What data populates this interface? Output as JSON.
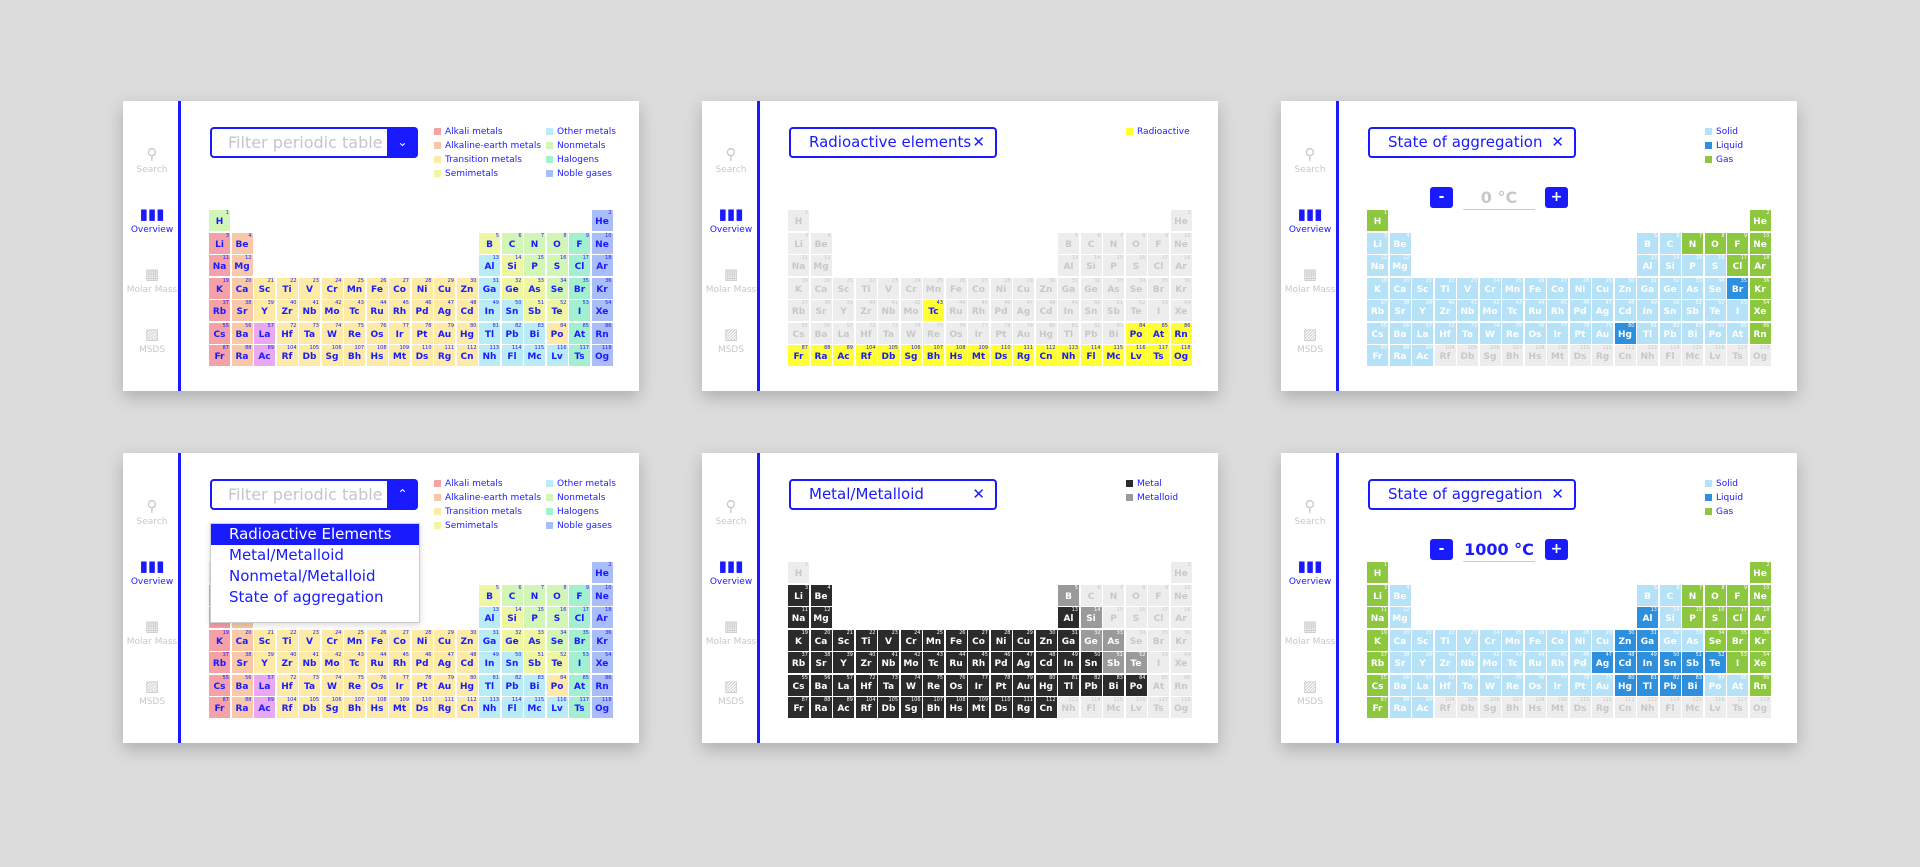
{
  "sidebar": {
    "items": [
      {
        "label": "Search",
        "icon": "search-icon"
      },
      {
        "label": "Overview",
        "icon": "chart-icon"
      },
      {
        "label": "Molar Mass",
        "icon": "calculator-icon"
      },
      {
        "label": "MSDS",
        "icon": "document-icon"
      }
    ]
  },
  "filter": {
    "placeholder": "Filter periodic table",
    "options": [
      "Radioactive Elements",
      "Metal/Metalloid",
      "Nonmetal/Metalloid",
      "State of aggregation"
    ]
  },
  "chips": {
    "radioactive": "Radioactive elements",
    "metal": "Metal/Metalloid",
    "state": "State of aggregation",
    "close": "✕"
  },
  "legends": {
    "categories": [
      {
        "label": "Alkali metals",
        "color": "#f4a1a8"
      },
      {
        "label": "Alkaline-earth metals",
        "color": "#f8c8a8"
      },
      {
        "label": "Transition metals",
        "color": "#fdeaa6"
      },
      {
        "label": "Semimetals",
        "color": "#eef5a3"
      },
      {
        "label": "Other metals",
        "color": "#b9ecf4"
      },
      {
        "label": "Nonmetals",
        "color": "#d2f6b5"
      },
      {
        "label": "Halogens",
        "color": "#a3f0d0"
      },
      {
        "label": "Noble gases",
        "color": "#a9bdf8"
      }
    ],
    "radioactive": [
      {
        "label": "Radioactive",
        "color": "#ffff33"
      }
    ],
    "metal": [
      {
        "label": "Metal",
        "color": "#2b2b2b"
      },
      {
        "label": "Metalloid",
        "color": "#9a9a9a"
      }
    ],
    "state": [
      {
        "label": "Solid",
        "color": "#b6e2f7"
      },
      {
        "label": "Liquid",
        "color": "#2e8fdc"
      },
      {
        "label": "Gas",
        "color": "#8dc63f"
      }
    ]
  },
  "temperature": {
    "low": "0 °C",
    "high": "1000 °C",
    "minus": "-",
    "plus": "+"
  },
  "colors": {
    "accent": "#1a1aff",
    "inactive": "#ededed"
  }
}
